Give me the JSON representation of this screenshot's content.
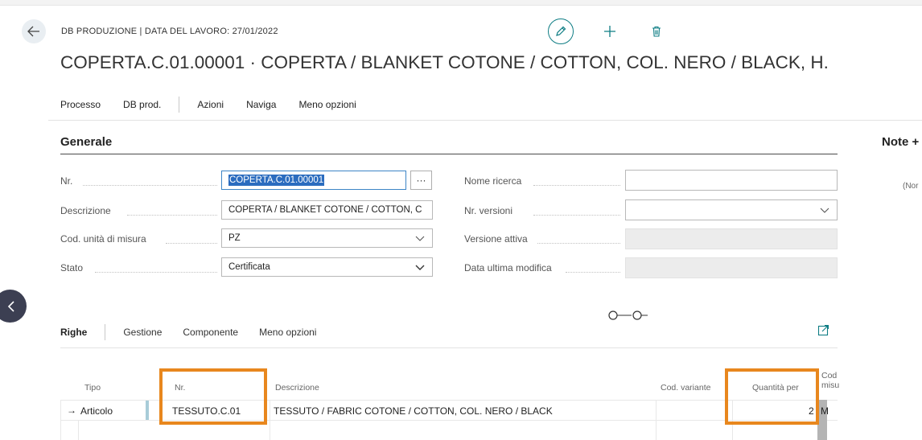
{
  "header": {
    "breadcrumb": "DB PRODUZIONE | DATA DEL LAVORO: 27/01/2022",
    "title": "COPERTA.C.01.00001 · COPERTA / BLANKET COTONE / COTTON, COL. NERO / BLACK, H."
  },
  "action_bar": [
    "Processo",
    "DB prod.",
    "Azioni",
    "Naviga",
    "Meno opzioni"
  ],
  "generale": {
    "section_title": "Generale",
    "nr_label": "Nr.",
    "nr_value": "COPERTA.C.01.00001",
    "descrizione_label": "Descrizione",
    "descrizione_value": "COPERTA / BLANKET COTONE / COTTON, C",
    "cod_unita_label": "Cod. unità di misura",
    "cod_unita_value": "PZ",
    "stato_label": "Stato",
    "stato_value": "Certificata",
    "nome_ricerca_label": "Nome ricerca",
    "nome_ricerca_value": "",
    "nr_versioni_label": "Nr. versioni",
    "nr_versioni_value": "",
    "versione_attiva_label": "Versione attiva",
    "data_ultima_label": "Data ultima modifica",
    "lookup_button": "···"
  },
  "note": {
    "title": "Note",
    "title_suffix": "+",
    "placeholder": "(Nor"
  },
  "righe": {
    "title": "Righe",
    "actions": [
      "Gestione",
      "Componente",
      "Meno opzioni"
    ],
    "columns": {
      "tipo": "Tipo",
      "nr": "Nr.",
      "descrizione": "Descrizione",
      "cod_variante": "Cod. variante",
      "quantita_per": "Quantità per",
      "cod_misura_line1": "Cod",
      "cod_misura_line2": "misu"
    },
    "rows": [
      {
        "arrow": "→",
        "tipo": "Articolo",
        "nr": "TESSUTO.C.01",
        "descrizione": "TESSUTO / FABRIC COTONE / COTTON, COL. NERO / BLACK",
        "cod_variante": "",
        "quantita_per": "2",
        "cod_misura": "M"
      }
    ]
  },
  "colors": {
    "accent": "#0e7d84",
    "highlight": "#e8871e",
    "selection": "#2b6cbf"
  },
  "icons": [
    "back-arrow-icon",
    "pencil-icon",
    "plus-icon",
    "trash-icon",
    "chevron-down-icon",
    "chevron-left-icon",
    "share-icon"
  ]
}
